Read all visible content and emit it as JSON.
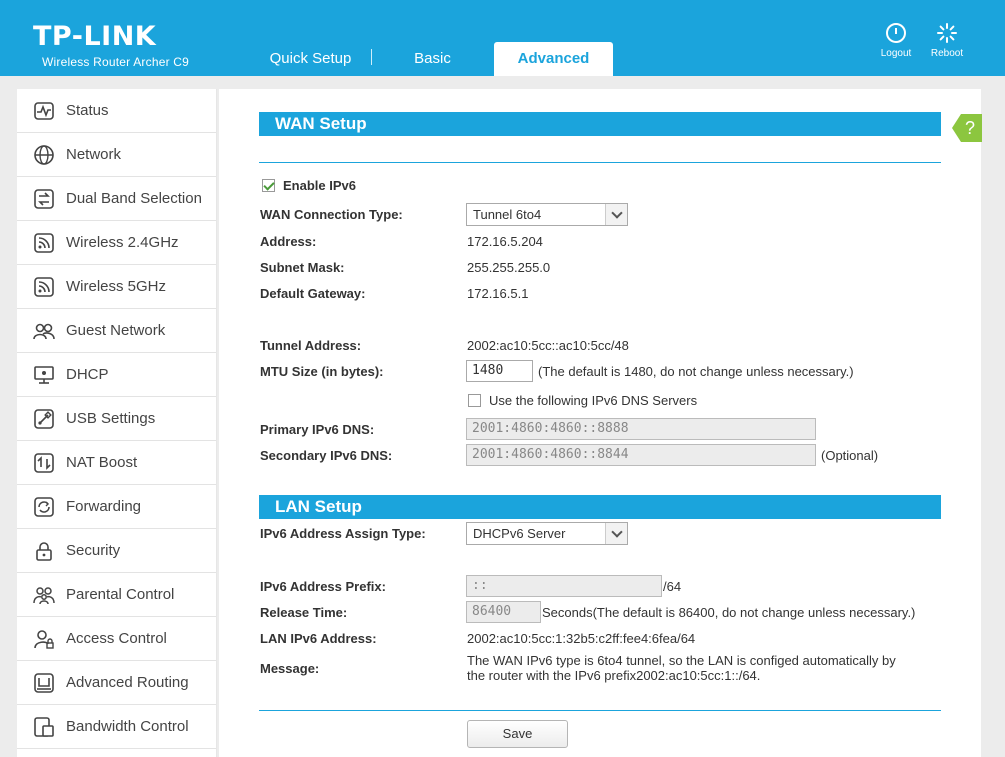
{
  "header": {
    "logo": "TP-LINK",
    "model": "Wireless Router Archer C9",
    "tabs": [
      {
        "label": "Quick Setup"
      },
      {
        "label": "Basic"
      },
      {
        "label": "Advanced"
      }
    ],
    "logout_label": "Logout",
    "reboot_label": "Reboot"
  },
  "sidebar": {
    "items": [
      {
        "label": "Status",
        "icon": "status-icon"
      },
      {
        "label": "Network",
        "icon": "globe-icon"
      },
      {
        "label": "Dual Band Selection",
        "icon": "dual-band-icon"
      },
      {
        "label": "Wireless 2.4GHz",
        "icon": "wireless-icon"
      },
      {
        "label": "Wireless 5GHz",
        "icon": "wireless-icon"
      },
      {
        "label": "Guest Network",
        "icon": "guest-icon"
      },
      {
        "label": "DHCP",
        "icon": "monitor-icon"
      },
      {
        "label": "USB Settings",
        "icon": "usb-icon"
      },
      {
        "label": "NAT Boost",
        "icon": "nat-boost-icon"
      },
      {
        "label": "Forwarding",
        "icon": "forwarding-icon"
      },
      {
        "label": "Security",
        "icon": "lock-icon"
      },
      {
        "label": "Parental Control",
        "icon": "parental-icon"
      },
      {
        "label": "Access Control",
        "icon": "access-icon"
      },
      {
        "label": "Advanced Routing",
        "icon": "routing-icon"
      },
      {
        "label": "Bandwidth Control",
        "icon": "bandwidth-icon"
      }
    ]
  },
  "help_label": "?",
  "wan": {
    "title": "WAN Setup",
    "enable_ipv6_label": "Enable IPv6",
    "enable_ipv6_checked": true,
    "connection_type_label": "WAN Connection Type:",
    "connection_type_value": "Tunnel 6to4",
    "address_label": "Address:",
    "address_value": "172.16.5.204",
    "subnet_label": "Subnet Mask:",
    "subnet_value": "255.255.255.0",
    "gateway_label": "Default Gateway:",
    "gateway_value": "172.16.5.1",
    "tunnel_label": "Tunnel Address:",
    "tunnel_value": "2002:ac10:5cc::ac10:5cc/48",
    "mtu_label": "MTU Size (in bytes):",
    "mtu_value": "1480",
    "mtu_hint": "(The default is 1480, do not change unless necessary.)",
    "use_dns_label": "Use the following IPv6 DNS Servers",
    "use_dns_checked": false,
    "primary_dns_label": "Primary IPv6 DNS:",
    "primary_dns_value": "2001:4860:4860::8888",
    "secondary_dns_label": "Secondary IPv6 DNS:",
    "secondary_dns_value": "2001:4860:4860::8844",
    "optional_label": "(Optional)"
  },
  "lan": {
    "title": "LAN Setup",
    "assign_type_label": "IPv6 Address Assign Type:",
    "assign_type_value": "DHCPv6 Server",
    "prefix_label": "IPv6 Address Prefix:",
    "prefix_value": "::",
    "prefix_suffix": "/64",
    "release_label": "Release Time:",
    "release_value": "86400",
    "release_hint": "Seconds(The default is 86400, do not change unless necessary.)",
    "lan_addr_label": "LAN IPv6 Address:",
    "lan_addr_value": "2002:ac10:5cc:1:32b5:c2ff:fee4:6fea/64",
    "message_label": "Message:",
    "message_line1": "The WAN IPv6 type is 6to4 tunnel, so the LAN is configed automatically by",
    "message_line2": "the router with the IPv6 prefix2002:ac10:5cc:1::/64."
  },
  "save_label": "Save"
}
